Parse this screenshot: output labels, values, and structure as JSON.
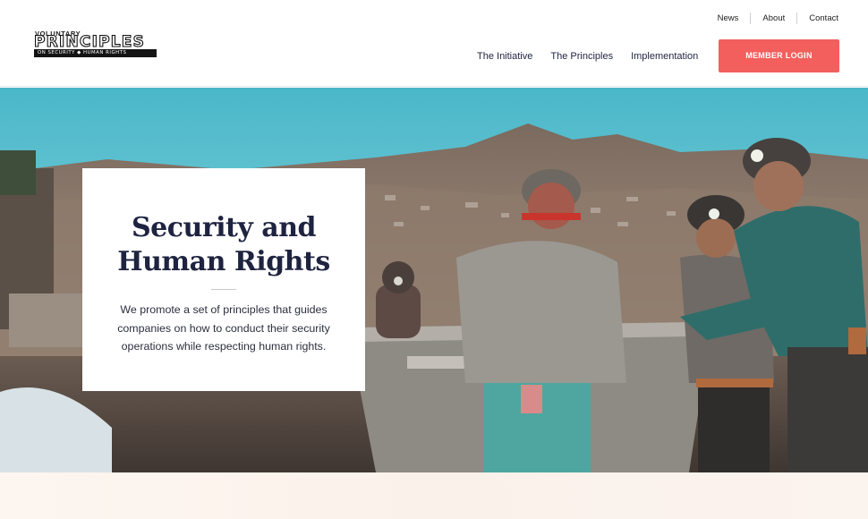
{
  "logo": {
    "line1": "VOLUNTARY",
    "line2": "PRINCIPLES",
    "line3": "ON SECURITY ◆ HUMAN RIGHTS"
  },
  "utility_nav": [
    "News",
    "About",
    "Contact"
  ],
  "main_nav": [
    "The Initiative",
    "The Principles",
    "Implementation"
  ],
  "login_button": "MEMBER LOGIN",
  "hero": {
    "title": "Security and Human Rights",
    "description": "We promote a set of principles that guides companies on how to conduct their security operations while respecting human rights."
  },
  "colors": {
    "accent": "#f25f5c",
    "navy": "#1e2340",
    "sky": "#5ec3d2"
  }
}
